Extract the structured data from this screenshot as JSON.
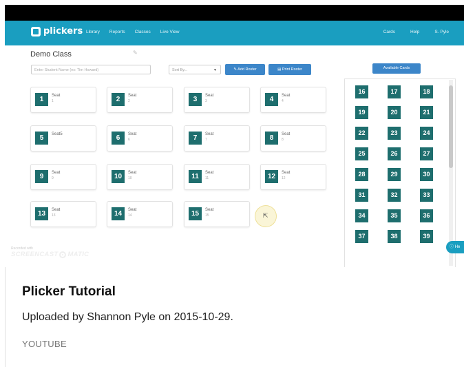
{
  "nav": {
    "brand": "plickers",
    "links": [
      "Library",
      "Reports",
      "Classes",
      "Live View"
    ],
    "right": [
      "Cards",
      "Help",
      "S. Pyle"
    ]
  },
  "toolbar": {
    "class_title": "Demo Class",
    "search_placeholder": "Enter Student Name (ex: Tim Howard)",
    "sort_label": "Sort By...",
    "add_roster": "Add Roster",
    "print_roster": "Print Roster",
    "available_cards": "Available Cards"
  },
  "seats": [
    {
      "num": "1",
      "label": "Seat",
      "sub": "1"
    },
    {
      "num": "2",
      "label": "Seat",
      "sub": "2"
    },
    {
      "num": "3",
      "label": "Seat",
      "sub": "3"
    },
    {
      "num": "4",
      "label": "Seat",
      "sub": "4"
    },
    {
      "num": "5",
      "label": "Seat5",
      "sub": ""
    },
    {
      "num": "6",
      "label": "Seat",
      "sub": "6"
    },
    {
      "num": "7",
      "label": "Seat",
      "sub": "7"
    },
    {
      "num": "8",
      "label": "Seat",
      "sub": "8"
    },
    {
      "num": "9",
      "label": "Seat",
      "sub": "9"
    },
    {
      "num": "10",
      "label": "Seat",
      "sub": "10"
    },
    {
      "num": "11",
      "label": "Seat",
      "sub": "11"
    },
    {
      "num": "12",
      "label": "Seat",
      "sub": "12"
    },
    {
      "num": "13",
      "label": "Seat",
      "sub": "13"
    },
    {
      "num": "14",
      "label": "Seat",
      "sub": "14"
    },
    {
      "num": "15",
      "label": "Seat",
      "sub": "15"
    }
  ],
  "cards": [
    "16",
    "17",
    "18",
    "19",
    "20",
    "21",
    "22",
    "23",
    "24",
    "25",
    "26",
    "27",
    "28",
    "29",
    "30",
    "31",
    "32",
    "33",
    "34",
    "35",
    "36",
    "37",
    "38",
    "39"
  ],
  "help_label": "He",
  "watermark": {
    "small": "Recorded with",
    "main": "SCREENCAST",
    "tail": "MATIC"
  },
  "caption": {
    "title": "Plicker Tutorial",
    "uploaded": "Uploaded by Shannon Pyle on 2015-10-29.",
    "source": "YOUTUBE"
  },
  "colors": {
    "nav": "#1a9ec0",
    "card": "#1e6e6e",
    "button": "#3c86c9"
  }
}
